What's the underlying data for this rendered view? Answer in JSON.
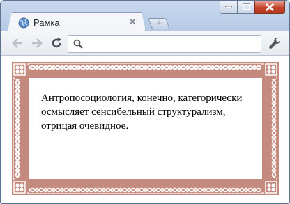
{
  "tab": {
    "title": "Рамка",
    "favicon": "globe-icon"
  },
  "toolbar": {
    "back_icon": "arrow-left-icon",
    "forward_icon": "arrow-right-icon",
    "reload_icon": "reload-icon",
    "address_value": "",
    "address_placeholder": "",
    "menu_icon": "wrench-icon"
  },
  "page": {
    "paragraph": "Антропосоциология, конечно, категорически осмысляет сенсибельный структурализм, отрицая очевидное."
  },
  "colors": {
    "frame": "#c58a7e",
    "window_chrome": "#c2d4eb",
    "close_button": "#c4432b"
  }
}
